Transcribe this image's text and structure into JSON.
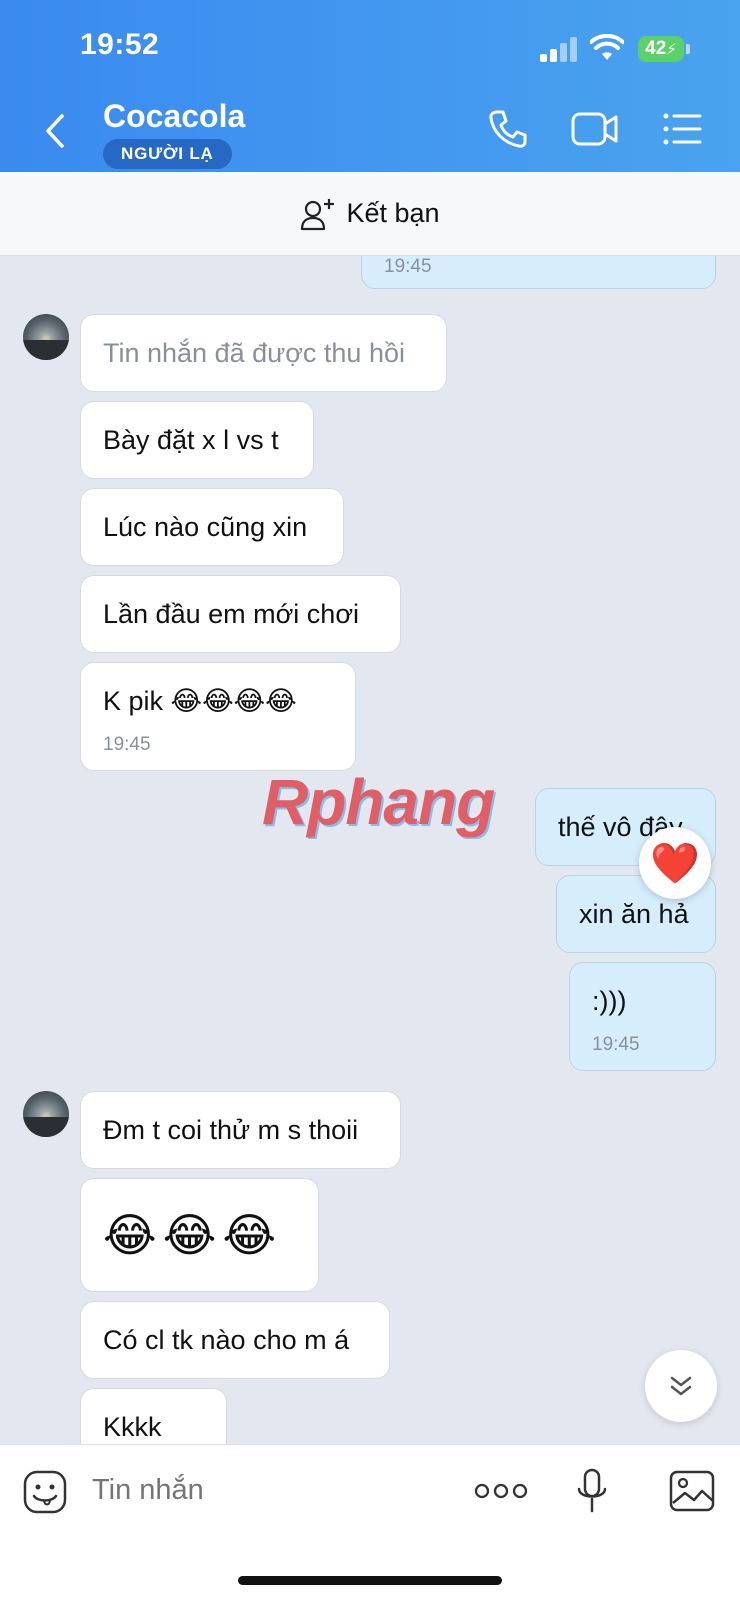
{
  "status_bar": {
    "time": "19:52",
    "battery": "42"
  },
  "header": {
    "contact_name": "Cocacola",
    "badge": "NGƯỜI LẠ",
    "icons": [
      "back-icon",
      "phone-icon",
      "video-call-icon",
      "menu-list-icon"
    ]
  },
  "add_friend": {
    "label": "Kết bạn",
    "icon": "add-user-icon"
  },
  "messages": {
    "m0_time": "19:45",
    "m1": "Tin nhắn đã được thu hồi",
    "m2": "Bày đặt x l vs t",
    "m3": "Lúc nào cũng xin",
    "m4": "Lần đầu em mới chơi",
    "m5": "K pik 😂😂😂😂",
    "m5_time": "19:45",
    "o1": "thế vô đây",
    "o2": "xin ăn hả",
    "o3": ":)))",
    "o3_time": "19:45",
    "m6": "Đm t coi thử m s thoii",
    "m7": "😂😂😂",
    "m8": "Có cl tk nào cho m á",
    "m9": "Kkkk"
  },
  "reaction": "❤️",
  "watermark": "Rphang",
  "input": {
    "placeholder": "Tin nhắn"
  },
  "colors": {
    "header_start": "#3a8af0",
    "header_end": "#4aa3ee",
    "outgoing_bubble": "#d6edfc",
    "incoming_bubble": "#ffffff",
    "chat_bg": "#e3e8f0"
  }
}
